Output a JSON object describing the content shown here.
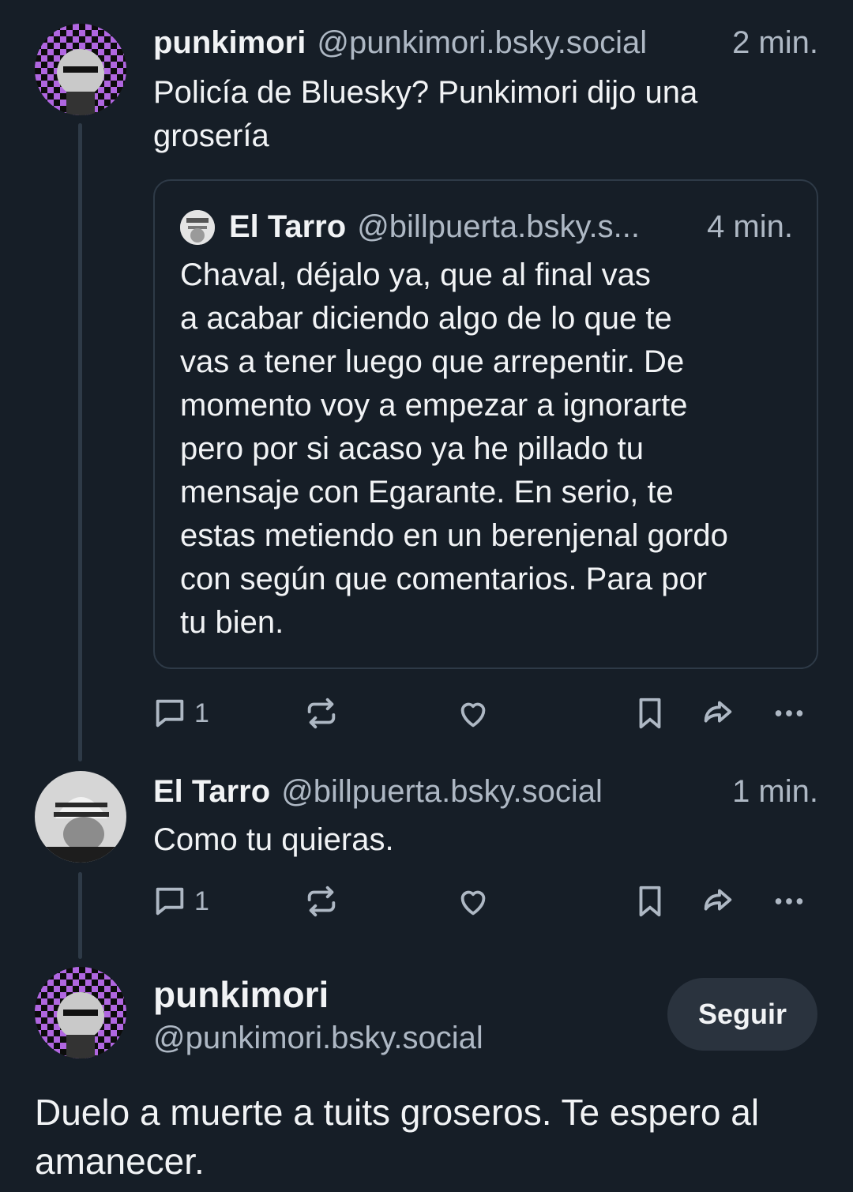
{
  "post1": {
    "author_name": "punkimori",
    "author_handle": "@punkimori.bsky.social",
    "time": "2 min.",
    "text_line1": "Policía de Bluesky? Punkimori dijo una",
    "text_line2": "grosería",
    "quote": {
      "author_name": "El Tarro",
      "author_handle": "@billpuerta.bsky.s...",
      "time": "4 min.",
      "lines": [
        "Chaval, déjalo ya, que al final vas",
        "a acabar diciendo algo de lo que te",
        "vas a tener luego que arrepentir. De",
        "momento voy a empezar a ignorarte",
        "pero por si acaso ya he pillado tu",
        "mensaje con Egarante. En serio, te",
        "estas metiendo en un berenjenal gordo",
        "con según que comentarios. Para por",
        "tu bien."
      ]
    },
    "reply_count": "1"
  },
  "post2": {
    "author_name": "El Tarro",
    "author_handle": "@billpuerta.bsky.social",
    "time": "1 min.",
    "text": "Como tu quieras.",
    "reply_count": "1"
  },
  "post3": {
    "author_name": "punkimori",
    "author_handle": "@punkimori.bsky.social",
    "follow_label": "Seguir",
    "text_line1": "Duelo a muerte a tuits groseros. Te espero al",
    "text_line2": "amanecer."
  },
  "icons": {
    "reply": "speech-bubble-icon",
    "repost": "repost-icon",
    "like": "heart-icon",
    "bookmark": "bookmark-icon",
    "share": "share-arrow-icon",
    "more": "ellipsis-icon"
  },
  "colors": {
    "background": "#161e27",
    "text": "#f1f3f5",
    "muted": "#aeb8c4",
    "border": "#2e3a47",
    "avatar_purple": "#a45ad8"
  }
}
